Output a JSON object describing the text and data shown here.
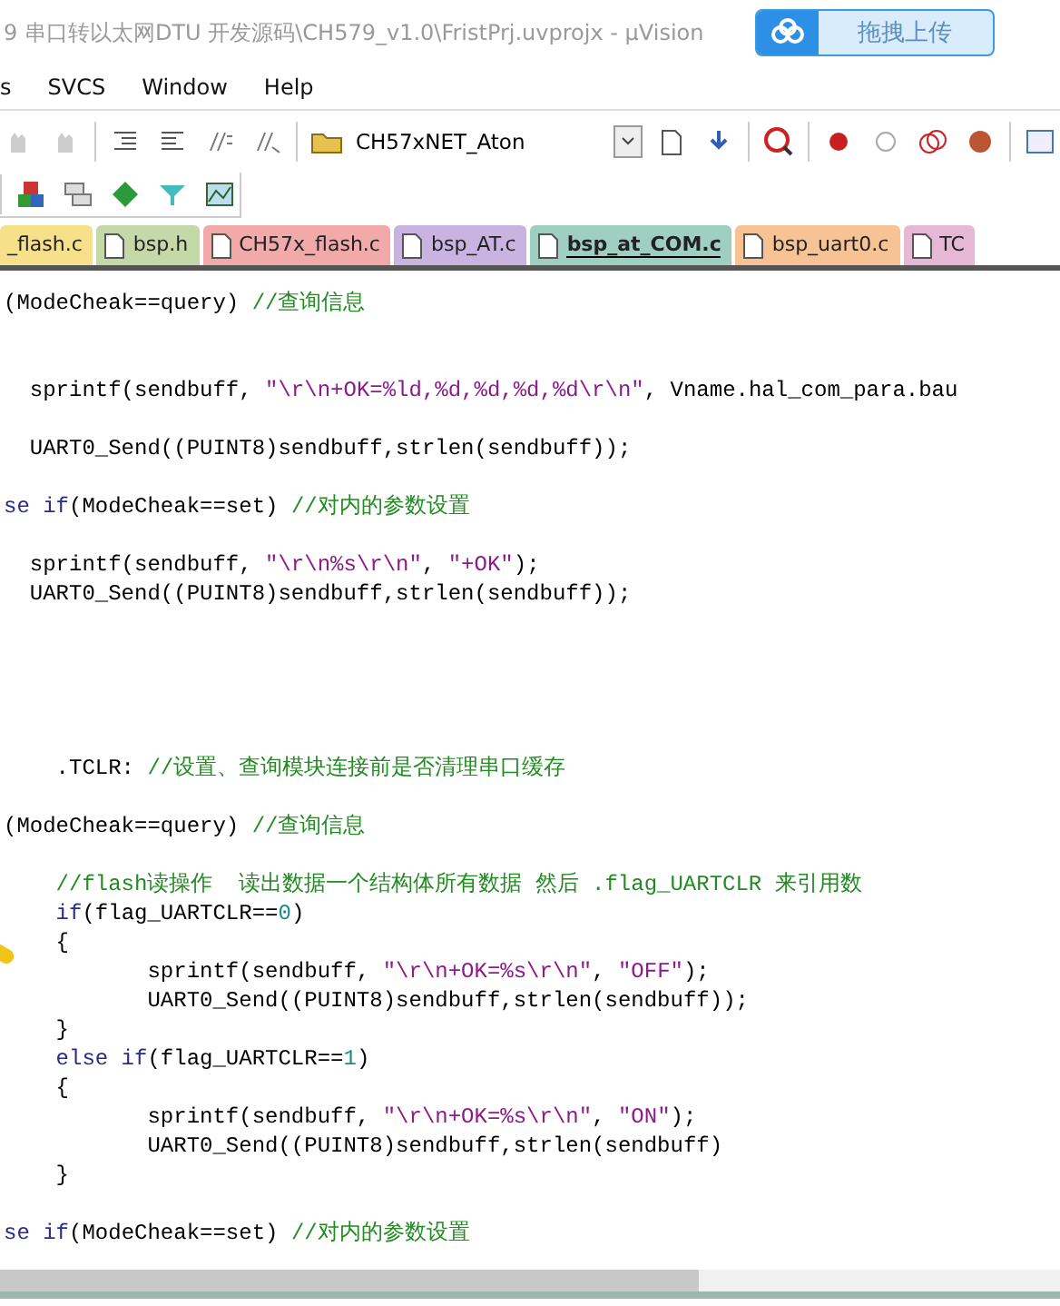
{
  "window": {
    "title": "9 串口转以太网DTU 开发源码\\CH579_v1.0\\FristPrj.uvprojx - µVision"
  },
  "upload_button": {
    "label": "拖拽上传"
  },
  "menu": [
    "s",
    "SVCS",
    "Window",
    "Help"
  ],
  "target_select": {
    "value": "CH57xNET_Aton"
  },
  "tabs": [
    {
      "label": "_flash.c",
      "selected": false,
      "color": "#f7e08a"
    },
    {
      "label": "bsp.h",
      "selected": false,
      "color": "#c5d9a8"
    },
    {
      "label": "CH57x_flash.c",
      "selected": false,
      "color": "#f2a9a9"
    },
    {
      "label": "bsp_AT.c",
      "selected": false,
      "color": "#c9b3e0"
    },
    {
      "label": "bsp_at_COM.c",
      "selected": true,
      "color": "#9fcfc0"
    },
    {
      "label": "bsp_uart0.c",
      "selected": false,
      "color": "#f7c394"
    },
    {
      "label": "TC",
      "selected": false,
      "color": "#e7b8d6"
    }
  ],
  "code_lines": [
    {
      "kind": "tight",
      "tokens": [
        {
          "kind": "plain",
          "text": "(ModeCheak==query) "
        },
        {
          "kind": "comment",
          "text": "//查询信息"
        }
      ]
    },
    {
      "kind": "double",
      "tokens": [
        {
          "kind": "plain",
          "text": "  sprintf(sendbuff, "
        },
        {
          "kind": "string",
          "text": "\"\\r\\n+OK=%ld,%d,%d,%d,%d\\r\\n\""
        },
        {
          "kind": "plain",
          "text": ", Vname.hal_com_para.bau"
        }
      ]
    },
    {
      "kind": "spaced",
      "tokens": [
        {
          "kind": "plain",
          "text": "  UART0_Send((PUINT8)sendbuff,strlen(sendbuff));"
        }
      ]
    },
    {
      "kind": "spaced",
      "tokens": [
        {
          "kind": "keyword",
          "text": "se if"
        },
        {
          "kind": "plain",
          "text": "(ModeCheak==set) "
        },
        {
          "kind": "comment",
          "text": "//对内的参数设置"
        }
      ]
    },
    {
      "kind": "spaced",
      "tokens": [
        {
          "kind": "plain",
          "text": "  sprintf(sendbuff, "
        },
        {
          "kind": "string",
          "text": "\"\\r\\n%s\\r\\n\""
        },
        {
          "kind": "plain",
          "text": ", "
        },
        {
          "kind": "string",
          "text": "\"+OK\""
        },
        {
          "kind": "plain",
          "text": ");"
        }
      ]
    },
    {
      "kind": "tight",
      "tokens": [
        {
          "kind": "plain",
          "text": "  UART0_Send((PUINT8)sendbuff,strlen(sendbuff));"
        }
      ]
    },
    {
      "kind": "section",
      "tokens": [
        {
          "kind": "plain",
          "text": "    .TCLR: "
        },
        {
          "kind": "comment",
          "text": "//设置、查询模块连接前是否清理串口缓存"
        }
      ]
    },
    {
      "kind": "spaced",
      "tokens": [
        {
          "kind": "plain",
          "text": "(ModeCheak==query) "
        },
        {
          "kind": "comment",
          "text": "//查询信息"
        }
      ]
    },
    {
      "kind": "spaced",
      "tokens": [
        {
          "kind": "comment",
          "text": "    //flash读操作  读出数据一个结构体所有数据 然后 .flag_UARTCLR 来引用数"
        }
      ]
    },
    {
      "kind": "tight",
      "tokens": [
        {
          "kind": "keyword",
          "text": "    if"
        },
        {
          "kind": "plain",
          "text": "(flag_UARTCLR=="
        },
        {
          "kind": "number",
          "text": "0"
        },
        {
          "kind": "plain",
          "text": ")"
        }
      ]
    },
    {
      "kind": "tight",
      "tokens": [
        {
          "kind": "plain",
          "text": "    {"
        }
      ]
    },
    {
      "kind": "tight",
      "tokens": [
        {
          "kind": "plain",
          "text": "           sprintf(sendbuff, "
        },
        {
          "kind": "string",
          "text": "\"\\r\\n+OK=%s\\r\\n\""
        },
        {
          "kind": "plain",
          "text": ", "
        },
        {
          "kind": "string",
          "text": "\"OFF\""
        },
        {
          "kind": "plain",
          "text": ");"
        }
      ]
    },
    {
      "kind": "tight",
      "tokens": [
        {
          "kind": "plain",
          "text": "           UART0_Send((PUINT8)sendbuff,strlen(sendbuff));"
        }
      ]
    },
    {
      "kind": "tight",
      "tokens": [
        {
          "kind": "plain",
          "text": "    }"
        }
      ]
    },
    {
      "kind": "tight",
      "tokens": [
        {
          "kind": "keyword",
          "text": "    else if"
        },
        {
          "kind": "plain",
          "text": "(flag_UARTCLR=="
        },
        {
          "kind": "number",
          "text": "1"
        },
        {
          "kind": "plain",
          "text": ")"
        }
      ]
    },
    {
      "kind": "tight",
      "tokens": [
        {
          "kind": "plain",
          "text": "    {"
        }
      ]
    },
    {
      "kind": "tight",
      "tokens": [
        {
          "kind": "plain",
          "text": "           sprintf(sendbuff, "
        },
        {
          "kind": "string",
          "text": "\"\\r\\n+OK=%s\\r\\n\""
        },
        {
          "kind": "plain",
          "text": ", "
        },
        {
          "kind": "string",
          "text": "\"ON\""
        },
        {
          "kind": "plain",
          "text": ");"
        }
      ]
    },
    {
      "kind": "tight",
      "tokens": [
        {
          "kind": "plain",
          "text": "           UART0_Send((PUINT8)sendbuff,strlen(sendbuff)"
        }
      ]
    },
    {
      "kind": "tight",
      "tokens": [
        {
          "kind": "plain",
          "text": "    }"
        }
      ]
    },
    {
      "kind": "spaced",
      "tokens": [
        {
          "kind": "keyword",
          "text": "se if"
        },
        {
          "kind": "plain",
          "text": "(ModeCheak==set) "
        },
        {
          "kind": "comment",
          "text": "//对内的参数设置"
        }
      ]
    }
  ]
}
